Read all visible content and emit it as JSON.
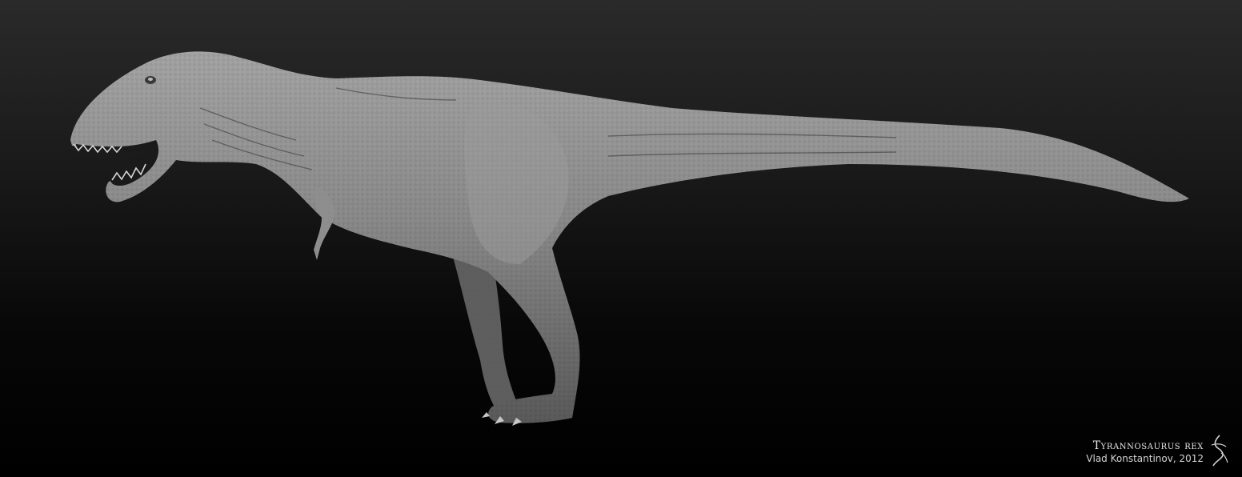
{
  "image": {
    "subject": "tyrannosaurus-render",
    "background_top": "#2a2a2a",
    "background_bottom": "#000000",
    "skin_color": "#8a8a8a"
  },
  "credit": {
    "title": "Tyrannosaurus rex",
    "author": "Vlad Konstantinov, 2012"
  }
}
